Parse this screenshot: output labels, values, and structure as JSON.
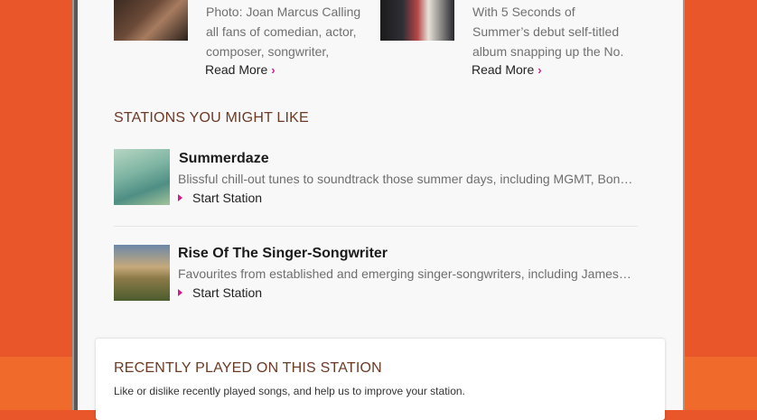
{
  "articles": [
    {
      "text": "Photo: Joan Marcus Calling all fans of comedian, actor, composer, songwriter,",
      "read_more": "Read More",
      "image": "portrait-photo"
    },
    {
      "text": "With 5 Seconds of Summer’s debut self-titled album snapping up the No.",
      "read_more": "Read More",
      "image": "band-photo"
    }
  ],
  "stations_section": {
    "title": "STATIONS YOU MIGHT LIKE",
    "items": [
      {
        "name": "Summerdaze",
        "description": "Blissful chill-out tunes to soundtrack those summer days, including MGMT, Bon…",
        "action": "Start Station"
      },
      {
        "name": "Rise Of The Singer-Songwriter",
        "description": "Favourites from established and emerging singer-songwriters, including James…",
        "action": "Start Station"
      }
    ]
  },
  "recently_played": {
    "title": "RECENTLY PLAYED ON THIS STATION",
    "description": "Like or dislike recently played songs, and help us to improve your station."
  },
  "icons": {
    "read_more": "chevron-right-icon",
    "start_station": "play-triangle-icon"
  },
  "colors": {
    "background": "#e8562a",
    "accent": "#d6198a",
    "section_title": "#6b3a25"
  }
}
